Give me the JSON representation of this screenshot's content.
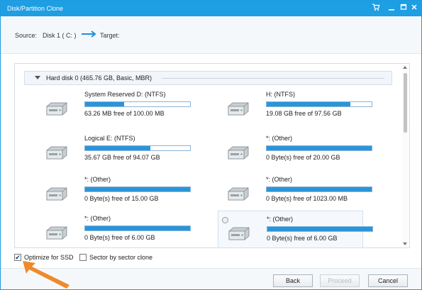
{
  "window": {
    "title": "Disk/Partition Clone"
  },
  "source": {
    "source_label": "Source:",
    "source_value": "Disk 1 ( C: )",
    "target_label": "Target:"
  },
  "disk": {
    "label": "Hard disk 0 (465.76 GB, Basic, MBR)"
  },
  "partitions": [
    {
      "name": "System Reserved D: (NTFS)",
      "free": "63.26 MB free of 100.00 MB",
      "used_fraction": 0.37,
      "selected": false
    },
    {
      "name": "H: (NTFS)",
      "free": "19.08 GB free of 97.56 GB",
      "used_fraction": 0.8,
      "selected": false
    },
    {
      "name": "Logical E: (NTFS)",
      "free": "35.67 GB free of 94.07 GB",
      "used_fraction": 0.62,
      "selected": false
    },
    {
      "name": "*: (Other)",
      "free": "0 Byte(s) free of 20.00 GB",
      "used_fraction": 1.0,
      "selected": false
    },
    {
      "name": "*: (Other)",
      "free": "0 Byte(s) free of 15.00 GB",
      "used_fraction": 1.0,
      "selected": false
    },
    {
      "name": "*: (Other)",
      "free": "0 Byte(s) free of 1023.00 MB",
      "used_fraction": 1.0,
      "selected": false
    },
    {
      "name": "*: (Other)",
      "free": "0 Byte(s) free of 6.00 GB",
      "used_fraction": 1.0,
      "selected": false
    },
    {
      "name": "*: (Other)",
      "free": "0 Byte(s) free of 6.00 GB",
      "used_fraction": 1.0,
      "selected": true
    }
  ],
  "options": {
    "optimize_ssd": {
      "label": "Optimize for SSD",
      "checked": true
    },
    "sector_clone": {
      "label": "Sector by sector clone",
      "checked": false
    }
  },
  "buttons": {
    "back": "Back",
    "proceed": "Proceed",
    "cancel": "Cancel"
  },
  "colors": {
    "titlebar": "#1e9ee3",
    "bar_fill": "#2a95d8",
    "pointer": "#f0892a"
  }
}
